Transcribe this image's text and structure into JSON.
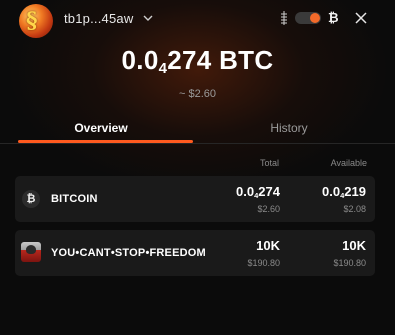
{
  "header": {
    "address": "tb1p...45aw",
    "network_symbol": "₿"
  },
  "balance": {
    "prefix": "0.0",
    "zeros_subscript": "4",
    "rest": "274",
    "unit": "BTC",
    "usd": "~ $2.60"
  },
  "tabs": [
    {
      "label": "Overview",
      "active": true
    },
    {
      "label": "History",
      "active": false
    }
  ],
  "table": {
    "headers": {
      "total": "Total",
      "available": "Available"
    },
    "rows": [
      {
        "name": "BITCOIN",
        "icon": "bitcoin-icon",
        "icon_glyph": "₿",
        "total_prefix": "0.0",
        "total_sub": "4",
        "total_rest": "274",
        "total_usd": "$2.60",
        "available_prefix": "0.0",
        "available_sub": "4",
        "available_rest": "219",
        "available_usd": "$2.08"
      },
      {
        "name": "YOU•CANT•STOP•FREEDOM",
        "icon": "rune-token-image",
        "total": "10K",
        "total_usd": "$190.80",
        "available": "10K",
        "available_usd": "$190.80"
      }
    ]
  },
  "colors": {
    "accent": "#ff5a1f",
    "background": "#0b0b0b",
    "row_bg": "#1a1a1a"
  }
}
